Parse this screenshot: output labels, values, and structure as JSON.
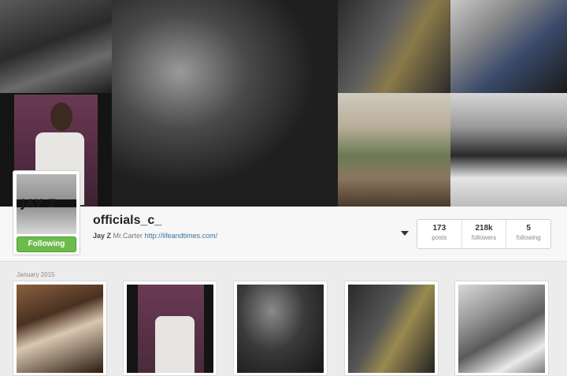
{
  "profile": {
    "username": "officials_c_",
    "full_name": "Jay Z",
    "bio_text": "Mr.Carter",
    "website": "http://lifeandtimes.com/",
    "avatar_logo_text": "JAY Z",
    "follow_button_label": "Following",
    "follow_button_color": "#6cbb4c"
  },
  "stats": [
    {
      "value": "173",
      "label": "posts"
    },
    {
      "value": "218k",
      "label": "followers"
    },
    {
      "value": "5",
      "label": "following"
    }
  ],
  "feed": {
    "section_label": "January 2015",
    "photo_count_visible": 5
  },
  "icons": {
    "options": "chevron-down-icon"
  },
  "colors": {
    "link": "#3f729b",
    "background": "#ececec"
  }
}
